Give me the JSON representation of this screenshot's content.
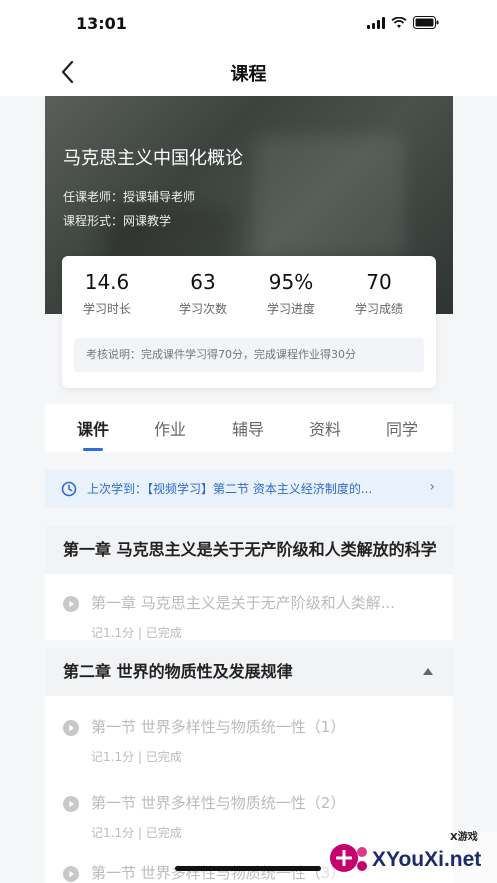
{
  "status": {
    "time": "13:01"
  },
  "nav": {
    "title": "课程"
  },
  "course": {
    "title": "马克思主义中国化概论",
    "teacher": "任课老师：授课辅导老师",
    "form": "课程形式：网课教学"
  },
  "stats": [
    {
      "value": "14.6",
      "label": "学习时长"
    },
    {
      "value": "63",
      "label": "学习次数"
    },
    {
      "value": "95%",
      "label": "学习进度"
    },
    {
      "value": "70",
      "label": "学习成绩"
    }
  ],
  "exam_note": "考核说明：完成课件学习得70分，完成课程作业得30分",
  "tabs": [
    "课件",
    "作业",
    "辅导",
    "资料",
    "同学"
  ],
  "resume": {
    "text": "上次学到：【视频学习】第二节 资本主义经济制度的...",
    "chevron": "›"
  },
  "chapters": [
    {
      "title": "第一章 马克思主义是关于无产阶级和人类解放的科学",
      "lessons": [
        {
          "title": "第一章 马克思主义是关于无产阶级和人类解...",
          "meta": "记1.1分 | 已完成"
        }
      ]
    },
    {
      "title": "第二章 世界的物质性及发展规律",
      "lessons": [
        {
          "title": "第一节 世界多样性与物质统一性（1）",
          "meta": "记1.1分 | 已完成"
        },
        {
          "title": "第一节 世界多样性与物质统一性（2）",
          "meta": "记1.1分 | 已完成"
        },
        {
          "title": "第一节 世界多样性与物质统一性（3）",
          "meta": ""
        }
      ]
    }
  ],
  "watermark": {
    "brand": "XYouXi.net",
    "tag": "X游戏"
  },
  "colors": {
    "accent": "#2a6fe0",
    "resume_bg": "#e9f1fb"
  }
}
